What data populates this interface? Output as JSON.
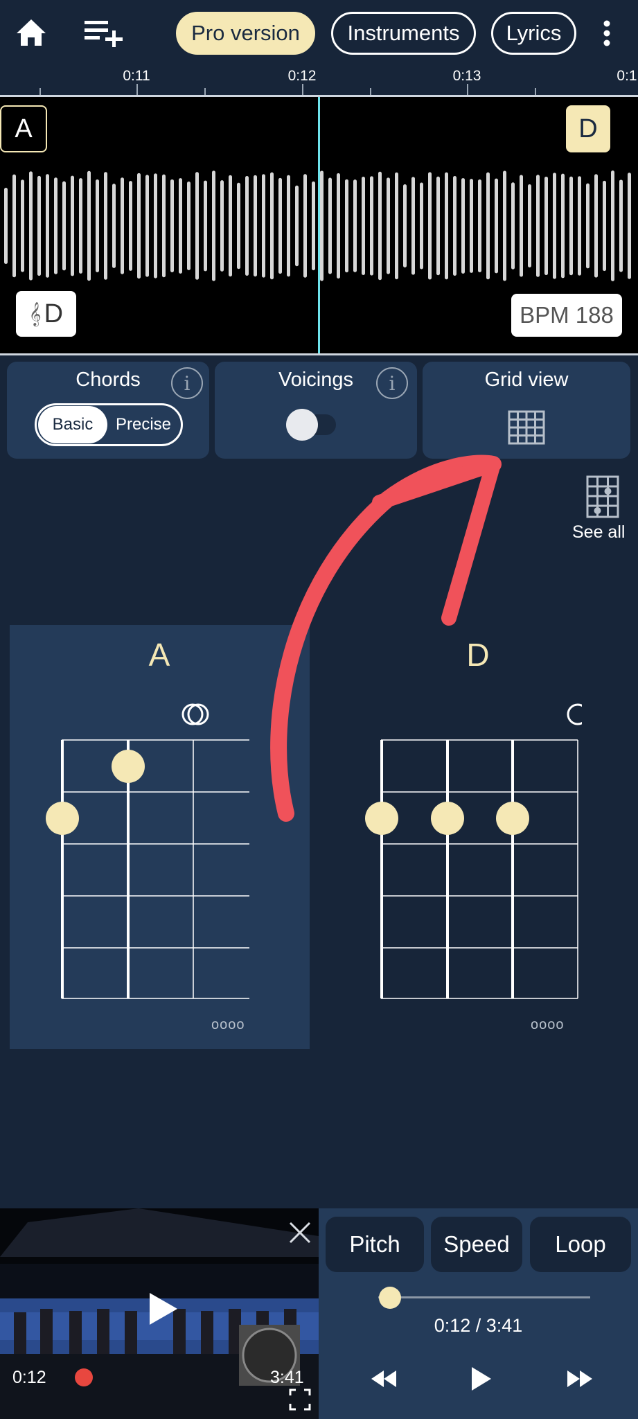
{
  "topbar": {
    "home_icon": "home-icon",
    "add_playlist_icon": "playlist-add-icon",
    "pro_label": "Pro version",
    "instruments_label": "Instruments",
    "lyrics_label": "Lyrics",
    "menu_icon": "more-vertical-icon"
  },
  "timeline": {
    "ticks": [
      "0:11",
      "0:12",
      "0:13",
      "0:1"
    ]
  },
  "waveform": {
    "chord_left": "A",
    "chord_right": "D",
    "key_symbol": "𝄞",
    "key": "D",
    "bpm": "BPM 188",
    "playhead_color": "#6fe3ec"
  },
  "cards": {
    "chords_title": "Chords",
    "chords_info": "i",
    "mode_basic": "Basic",
    "mode_precise": "Precise",
    "mode_selected": "Basic",
    "voicings_title": "Voicings",
    "voicings_info": "i",
    "voicings_enabled": false,
    "grid_title": "Grid view",
    "grid_icon": "grid-icon"
  },
  "see_all": {
    "label": "See all",
    "icon": "chord-grid-icon"
  },
  "chords": [
    {
      "name": "A",
      "more": "oooo"
    },
    {
      "name": "D",
      "more": "oooo"
    }
  ],
  "annotation": {
    "color": "#f0525a",
    "icon": "arrow-annotation"
  },
  "video": {
    "close_icon": "close-icon",
    "play_icon": "play-icon",
    "current": "0:12",
    "duration": "3:41",
    "fullscreen_icon": "fullscreen-icon"
  },
  "controls": {
    "pitch": "Pitch",
    "speed": "Speed",
    "loop": "Loop",
    "progress_fraction": 0.054,
    "time": "0:12 / 3:41",
    "rewind_icon": "rewind-icon",
    "play_icon": "play-icon",
    "forward_icon": "fast-forward-icon"
  },
  "colors": {
    "background": "#172539",
    "panel": "#243b59",
    "accent": "#f5e8b5"
  }
}
